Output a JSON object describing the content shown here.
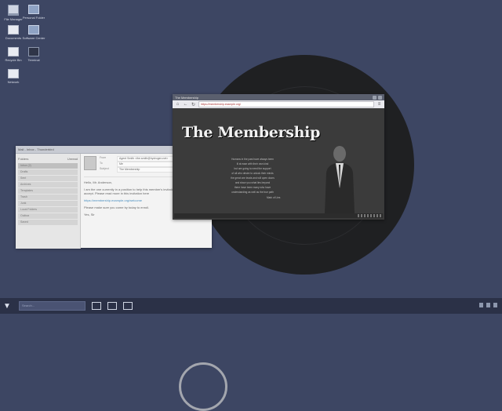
{
  "desktop": {
    "icons": [
      {
        "label": "File Manager",
        "icon": "folder-icon"
      },
      {
        "label": "Personal Folder",
        "icon": "home-folder-icon"
      },
      {
        "label": "Documents",
        "icon": "documents-icon"
      },
      {
        "label": "Software Center",
        "icon": "software-icon"
      },
      {
        "label": "Recycle Bin",
        "icon": "trash-icon"
      },
      {
        "label": "Terminal",
        "icon": "terminal-icon"
      },
      {
        "label": "Network",
        "icon": "network-icon"
      }
    ]
  },
  "mail": {
    "title": "Mail - Inbox - Thunderbird",
    "folders_header": "Folders",
    "folders_count": "Unread",
    "folders": [
      "Inbox (2)",
      "Drafts",
      "Sent",
      "Archives",
      "Templates",
      "Trash",
      "Junk",
      "Local Folders",
      "Outbox",
      "Saved"
    ],
    "header": {
      "from_label": "From",
      "from_value": "Agent Smith <the.smith@hydrogen.net>",
      "to_label": "To",
      "to_value": "Me",
      "subject_label": "Subject",
      "subject_value": "The Membership"
    },
    "greeting": "Hello, Mr. Anderson,",
    "body1": "I am the one currently in a position to help this member's invitation and I wish you to accept. Please read more in this invitation here",
    "link": "https://membership.example.org/welcome",
    "body2": "Please make sure you come by today to enroll.",
    "signoff": "Yes, Sir"
  },
  "browser": {
    "title": "The Membership",
    "url": "https://membership.example.org/",
    "site_title": "The Membership",
    "poem": [
      "Humans in the past have always been",
      "ill at ease with their own kind",
      "but are going to need the support",
      "of all who desire to unlock their minds",
      "the great one leads and will open doors",
      "and show you what lies beyond",
      "there have been many who have",
      "understanding as well as the true path"
    ],
    "signature": "Mark of Lies"
  },
  "taskbar": {
    "search_placeholder": "Search..."
  }
}
